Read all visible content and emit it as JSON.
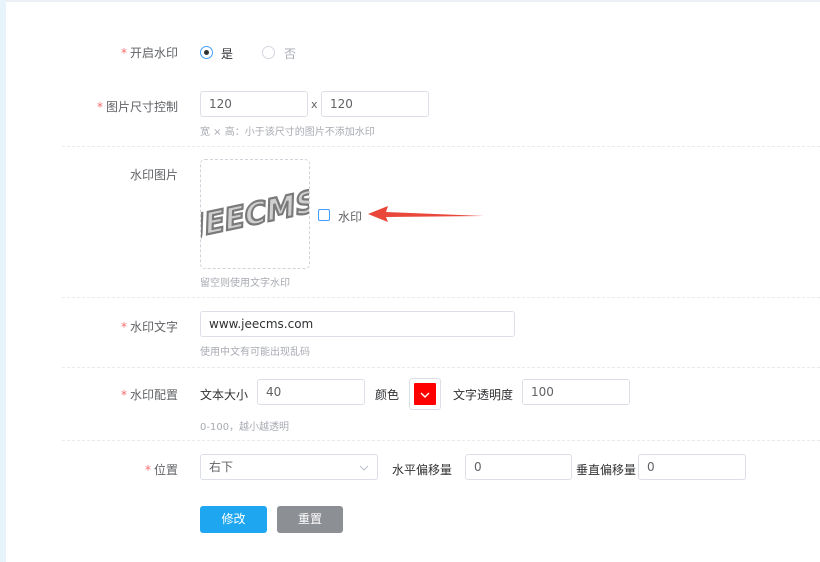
{
  "form": {
    "enable": {
      "label": "开启水印",
      "yes": "是",
      "no": "否"
    },
    "size": {
      "label": "图片尺寸控制",
      "width": "120",
      "times": "x",
      "height": "120",
      "hint": "宽 × 高：小于该尺寸的图片不添加水印"
    },
    "image": {
      "label": "水印图片",
      "logo_text": "JEECMS",
      "checkbox_label": "水印",
      "hint": "留空则使用文字水印"
    },
    "text": {
      "label": "水印文字",
      "value": "www.jeecms.com",
      "hint": "使用中文有可能出现乱码"
    },
    "config": {
      "label": "水印配置",
      "font_size_label": "文本大小",
      "font_size": "40",
      "color_label": "颜色",
      "color_value": "#ff0000",
      "opacity_label": "文字透明度",
      "opacity": "100",
      "hint": "0-100，越小越透明"
    },
    "position": {
      "label": "位置",
      "selected": "右下",
      "h_offset_label": "水平偏移量",
      "h_offset": "0",
      "v_offset_label": "垂直偏移量",
      "v_offset": "0"
    },
    "buttons": {
      "submit": "修改",
      "reset": "重置"
    }
  },
  "colors": {
    "primary": "#1ea7f0",
    "reset": "#8c8f94",
    "required": "#f56c6c",
    "arrow": "#e8473a"
  }
}
